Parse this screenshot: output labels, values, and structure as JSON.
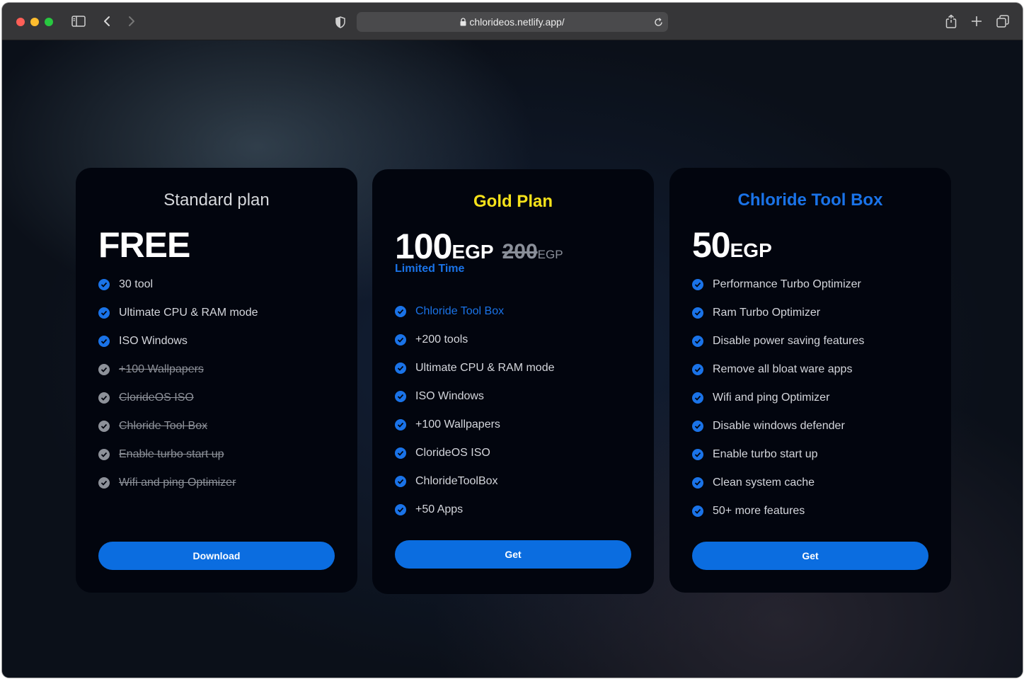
{
  "browser": {
    "url": "chlorideos.netlify.app/"
  },
  "plans": [
    {
      "title": "Standard plan",
      "title_color": "#d6d8dc",
      "price": "FREE",
      "features": [
        {
          "label": "30 tool",
          "included": true
        },
        {
          "label": "Ultimate CPU & RAM mode",
          "included": true
        },
        {
          "label": "ISO Windows",
          "included": true
        },
        {
          "label": "+100 Wallpapers",
          "included": false
        },
        {
          "label": "CloridеOS ISO",
          "included": false
        },
        {
          "label": "Chloride Tool Box",
          "included": false
        },
        {
          "label": "Enable turbo start up",
          "included": false
        },
        {
          "label": "Wifi and ping Optimizer",
          "included": false
        }
      ],
      "button": "Download"
    },
    {
      "title": "Gold Plan",
      "title_color": "#f6e21a",
      "price": "100",
      "currency": "EGP",
      "old_price": "200",
      "old_currency": "EGP",
      "note": "Limited Time",
      "features": [
        {
          "label": "Chloride Tool Box",
          "included": true,
          "highlight": true
        },
        {
          "label": "+200 tools",
          "included": true
        },
        {
          "label": "Ultimate CPU & RAM mode",
          "included": true
        },
        {
          "label": "ISO Windows",
          "included": true
        },
        {
          "label": "+100 Wallpapers",
          "included": true
        },
        {
          "label": "ClorideOS ISO",
          "included": true
        },
        {
          "label": "ChlorideToolBox",
          "included": true
        },
        {
          "label": "+50 Apps",
          "included": true
        }
      ],
      "button": "Get"
    },
    {
      "title": "Chloride Tool Box",
      "title_color": "#1a73e8",
      "price": "50",
      "currency": "EGP",
      "features": [
        {
          "label": "Performance Turbo Optimizer",
          "included": true
        },
        {
          "label": "Ram Turbo Optimizer",
          "included": true
        },
        {
          "label": "Disable power saving features",
          "included": true
        },
        {
          "label": "Remove all bloat ware apps",
          "included": true
        },
        {
          "label": "Wifi and ping Optimizer",
          "included": true
        },
        {
          "label": "Disable windows defender",
          "included": true
        },
        {
          "label": "Enable turbo start up",
          "included": true
        },
        {
          "label": "Clean system cache",
          "included": true
        },
        {
          "label": "50+ more features",
          "included": true
        }
      ],
      "button": "Get"
    }
  ],
  "icons": {
    "traffic_lights": [
      "close-dot",
      "minimize-dot",
      "zoom-dot"
    ],
    "toolbar": [
      "sidebar-icon",
      "back-icon",
      "forward-icon",
      "shield-icon",
      "lock-icon",
      "reload-icon",
      "share-icon",
      "new-tab-icon",
      "tabs-overview-icon"
    ],
    "feature_bullet": "check-circle-icon"
  }
}
